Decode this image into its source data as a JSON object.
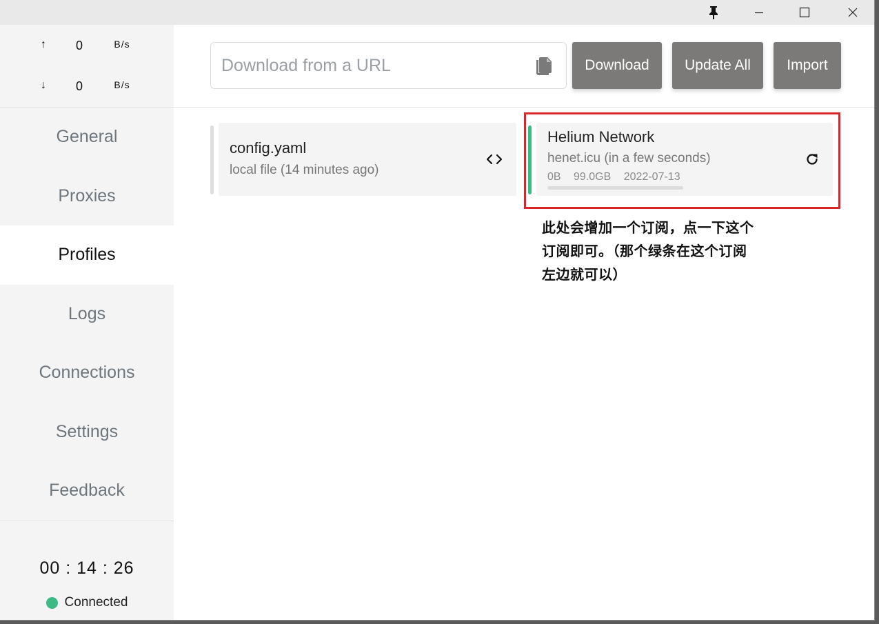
{
  "traffic": {
    "up_arrow": "↑",
    "up_value": "0",
    "up_unit": "B/s",
    "down_arrow": "↓",
    "down_value": "0",
    "down_unit": "B/s"
  },
  "nav": {
    "items": [
      {
        "label": "General"
      },
      {
        "label": "Proxies"
      },
      {
        "label": "Profiles",
        "active": true
      },
      {
        "label": "Logs"
      },
      {
        "label": "Connections"
      },
      {
        "label": "Settings"
      },
      {
        "label": "Feedback"
      }
    ]
  },
  "footer": {
    "timer": "00 : 14 : 26",
    "status": "Connected",
    "status_color": "#3dba84"
  },
  "header": {
    "url_placeholder": "Download from a URL",
    "url_value": "",
    "download_label": "Download",
    "update_all_label": "Update All",
    "import_label": "Import",
    "button_color": "#7b7a78"
  },
  "profiles": [
    {
      "name": "config.yaml",
      "subtitle": "local file (14 minutes ago)",
      "icon": "code-icon",
      "selected": false
    },
    {
      "name": "Helium Network",
      "subtitle": "henet.icu (in a few seconds)",
      "used": "0B",
      "total": "99.0GB",
      "expire": "2022-07-13",
      "usage_fraction": 0,
      "icon": "refresh-icon",
      "selected": true,
      "accent_color": "#3dba84"
    }
  ],
  "annotation": {
    "lines": [
      "此处会增加一个订阅，点一下这个",
      "订阅即可。（那个绿条在这个订阅",
      "左边就可以）"
    ],
    "box_color": "#d9262c"
  }
}
